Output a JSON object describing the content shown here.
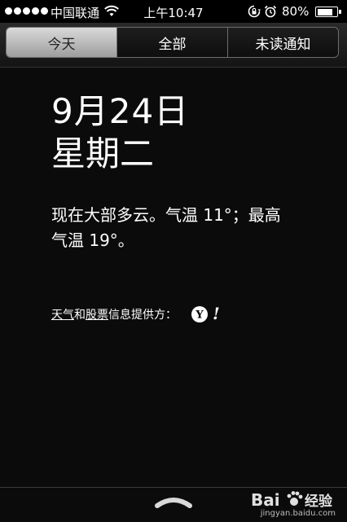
{
  "status_bar": {
    "carrier": "中国联通",
    "time": "上午10:47",
    "battery_percent": "80%",
    "battery_level": 0.8,
    "icons": [
      "signal-dots",
      "wifi-icon",
      "orientation-lock-icon",
      "alarm-icon",
      "battery-icon"
    ]
  },
  "tabs": [
    {
      "label": "今天",
      "active": true
    },
    {
      "label": "全部",
      "active": false
    },
    {
      "label": "未读通知",
      "active": false
    }
  ],
  "today": {
    "date": "9月24日",
    "weekday": "星期二",
    "weather_line1": "现在大部多云。气温 11°；最高",
    "weather_line2": "气温 19°。",
    "provider_link_weather": "天气",
    "provider_and": "和",
    "provider_link_stocks": "股票",
    "provider_suffix": "信息提供方：",
    "provider_logo": "Y!"
  },
  "watermark": {
    "brand": "Bai",
    "brand_suffix": "经验",
    "url": "jingyan.baidu.com"
  },
  "colors": {
    "background": "#0b0b0b",
    "active_tab": "#c4c4c4",
    "text": "#ffffff"
  }
}
